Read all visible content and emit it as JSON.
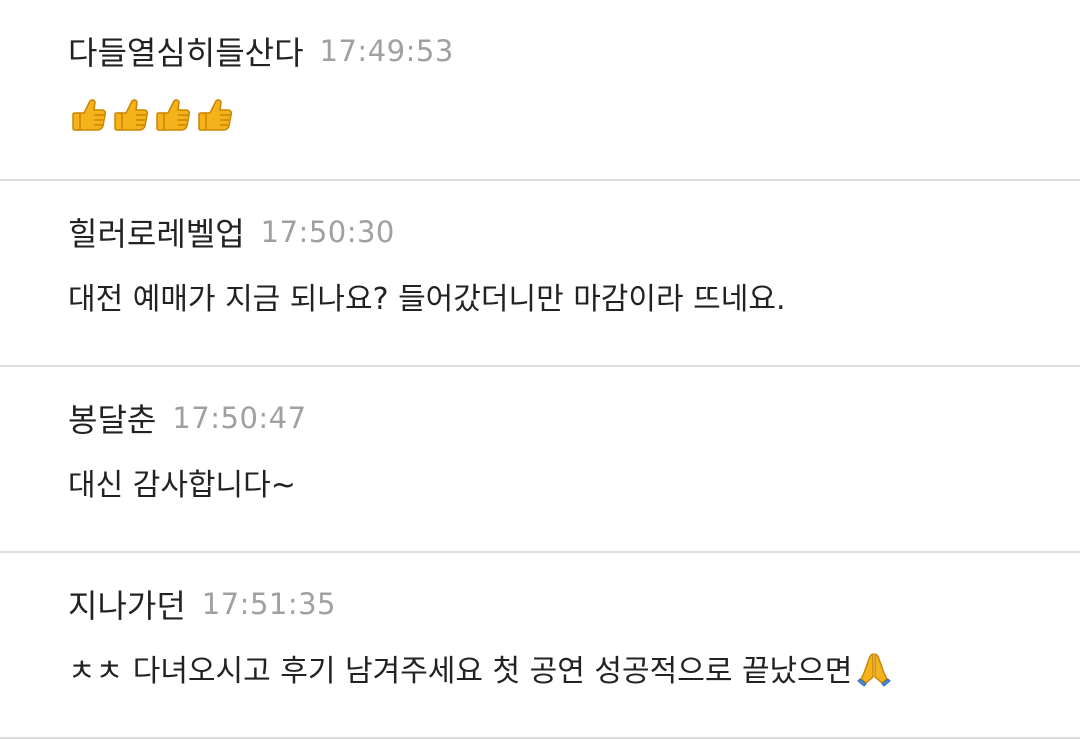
{
  "messages": [
    {
      "author": "다들열심히들산다",
      "time": "17:49:53",
      "text": "",
      "emojis": [
        "thumbs-up-icon",
        "thumbs-up-icon",
        "thumbs-up-icon",
        "thumbs-up-icon"
      ]
    },
    {
      "author": "힐러로레벨업",
      "time": "17:50:30",
      "text": "대전 예매가 지금 되나요? 들어갔더니만 마감이라 뜨네요."
    },
    {
      "author": "봉달춘",
      "time": "17:50:47",
      "text": "대신 감사합니다~"
    },
    {
      "author": "지나가던",
      "time": "17:51:35",
      "text": "ㅊㅊ 다녀오시고 후기 남겨주세요 첫 공연 성공적으로 끝났으면",
      "emojis": [
        "folded-hands-icon"
      ]
    }
  ],
  "colors": {
    "name": "#222222",
    "time": "#a0a0a0",
    "divider": "#dcdcdc",
    "emoji_yellow": "#f6b21a"
  }
}
